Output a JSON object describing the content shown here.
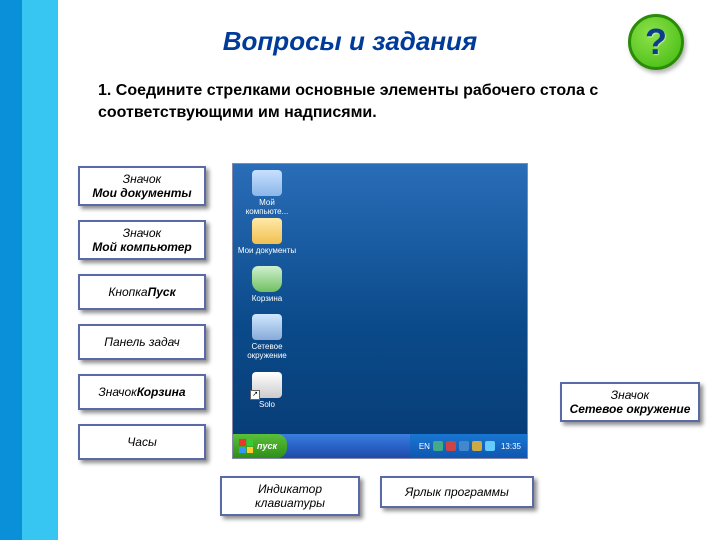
{
  "title": "Вопросы и задания",
  "qmark": "?",
  "instruction": {
    "num": "1.",
    "text": "Соедините стрелками основные элементы рабочего стола с соответствующими им надписями."
  },
  "leftLabels": [
    {
      "line1": "Значок",
      "line2": "Мои документы"
    },
    {
      "line1": "Значок",
      "line2": "Мой компьютер"
    },
    {
      "line1": "Кнопка ",
      "line2": "Пуск"
    },
    {
      "line1": "Панель задач",
      "line2": ""
    },
    {
      "line1": "Значок ",
      "line2": "Корзина"
    },
    {
      "line1": "Часы",
      "line2": ""
    }
  ],
  "rightLabel": {
    "line1": "Значок",
    "line2": "Сетевое окружение"
  },
  "bottomLabels": {
    "keyboard": "Индикатор клавиатуры",
    "shortcut": "Ярлык программы"
  },
  "desktop": {
    "icons": [
      {
        "name": "Мой компьюте..."
      },
      {
        "name": "Мои документы"
      },
      {
        "name": "Корзина"
      },
      {
        "name": "Сетевое окружение"
      },
      {
        "name": "Solo"
      }
    ],
    "start": "пуск",
    "lang": "EN",
    "time": "13:35"
  }
}
